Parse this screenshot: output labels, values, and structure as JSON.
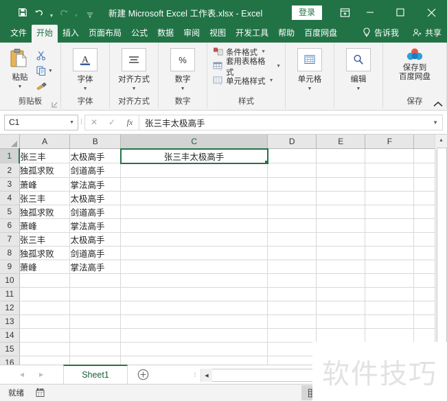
{
  "window": {
    "title": "新建 Microsoft Excel 工作表.xlsx  -  Excel",
    "signin_label": "登录",
    "quick_access": [
      {
        "name": "save-icon",
        "label": "保存"
      },
      {
        "name": "undo-icon",
        "label": "撤消"
      },
      {
        "name": "redo-icon",
        "label": "恢复"
      },
      {
        "name": "customize-qat-icon",
        "label": "自定义快速访问工具栏"
      }
    ],
    "buttons": {
      "ribbon_display": "功能区显示选项",
      "minimize": "最小化",
      "maximize": "最大化",
      "close": "关闭"
    }
  },
  "tabs": [
    {
      "label": "文件",
      "active": false
    },
    {
      "label": "开始",
      "active": true
    },
    {
      "label": "插入",
      "active": false
    },
    {
      "label": "页面布局",
      "active": false
    },
    {
      "label": "公式",
      "active": false
    },
    {
      "label": "数据",
      "active": false
    },
    {
      "label": "审阅",
      "active": false
    },
    {
      "label": "视图",
      "active": false
    },
    {
      "label": "开发工具",
      "active": false
    },
    {
      "label": "帮助",
      "active": false
    },
    {
      "label": "百度网盘",
      "active": false
    }
  ],
  "tab_right": {
    "tell_me": "告诉我",
    "share": "共享"
  },
  "ribbon": {
    "clipboard": {
      "group_label": "剪贴板",
      "paste_label": "粘贴",
      "cut_label": "剪切",
      "copy_label": "复制",
      "format_painter_label": "格式刷"
    },
    "font": {
      "group_label": "字体",
      "button_label": "字体"
    },
    "alignment": {
      "group_label": "对齐方式",
      "button_label": "对齐方式"
    },
    "number": {
      "group_label": "数字",
      "button_label": "数字",
      "icon": "%"
    },
    "styles": {
      "group_label": "样式",
      "items": [
        {
          "label": "条件格式"
        },
        {
          "label": "套用表格格式"
        },
        {
          "label": "单元格样式"
        }
      ]
    },
    "cells": {
      "group_label": "",
      "button_label": "单元格"
    },
    "editing": {
      "group_label": "",
      "button_label": "编辑"
    },
    "save": {
      "group_label": "保存",
      "button_line1": "保存到",
      "button_line2": "百度网盘"
    }
  },
  "formula_bar": {
    "name_box": "C1",
    "cancel_icon": "✕",
    "enter_icon": "✓",
    "fx_icon": "fx",
    "value": "张三丰太极高手"
  },
  "sheet": {
    "columns": [
      "A",
      "B",
      "C",
      "D",
      "E",
      "F"
    ],
    "selected_column": "C",
    "selected_row": 1,
    "selected_cell": "C1",
    "rows": [
      {
        "num": "1",
        "A": "张三丰",
        "B": "太极高手",
        "C": "张三丰太极高手"
      },
      {
        "num": "2",
        "A": "独孤求败",
        "B": "剑道高手",
        "C": ""
      },
      {
        "num": "3",
        "A": "萧峰",
        "B": "掌法高手",
        "C": ""
      },
      {
        "num": "4",
        "A": "张三丰",
        "B": "太极高手",
        "C": ""
      },
      {
        "num": "5",
        "A": "独孤求败",
        "B": "剑道高手",
        "C": ""
      },
      {
        "num": "6",
        "A": "萧峰",
        "B": "掌法高手",
        "C": ""
      },
      {
        "num": "7",
        "A": "张三丰",
        "B": "太极高手",
        "C": ""
      },
      {
        "num": "8",
        "A": "独孤求败",
        "B": "剑道高手",
        "C": ""
      },
      {
        "num": "9",
        "A": "萧峰",
        "B": "掌法高手",
        "C": ""
      },
      {
        "num": "10",
        "A": "",
        "B": "",
        "C": ""
      },
      {
        "num": "11",
        "A": "",
        "B": "",
        "C": ""
      },
      {
        "num": "12",
        "A": "",
        "B": "",
        "C": ""
      },
      {
        "num": "13",
        "A": "",
        "B": "",
        "C": ""
      },
      {
        "num": "14",
        "A": "",
        "B": "",
        "C": ""
      },
      {
        "num": "15",
        "A": "",
        "B": "",
        "C": ""
      },
      {
        "num": "16",
        "A": "",
        "B": "",
        "C": ""
      }
    ]
  },
  "sheet_tabs": {
    "tabs": [
      {
        "label": "Sheet1",
        "active": true
      }
    ],
    "add_label": "+"
  },
  "status_bar": {
    "state": "就绪",
    "views": [
      {
        "name": "normal-view",
        "active": true
      },
      {
        "name": "page-layout-view",
        "active": false
      },
      {
        "name": "page-break-view",
        "active": false
      }
    ]
  },
  "watermark": {
    "text": "软件技巧"
  },
  "colors": {
    "brand_green": "#217346",
    "ribbon_bg": "#f3f3f3",
    "grid_line": "#d8d8d8",
    "header_bg": "#e7e7e7"
  }
}
